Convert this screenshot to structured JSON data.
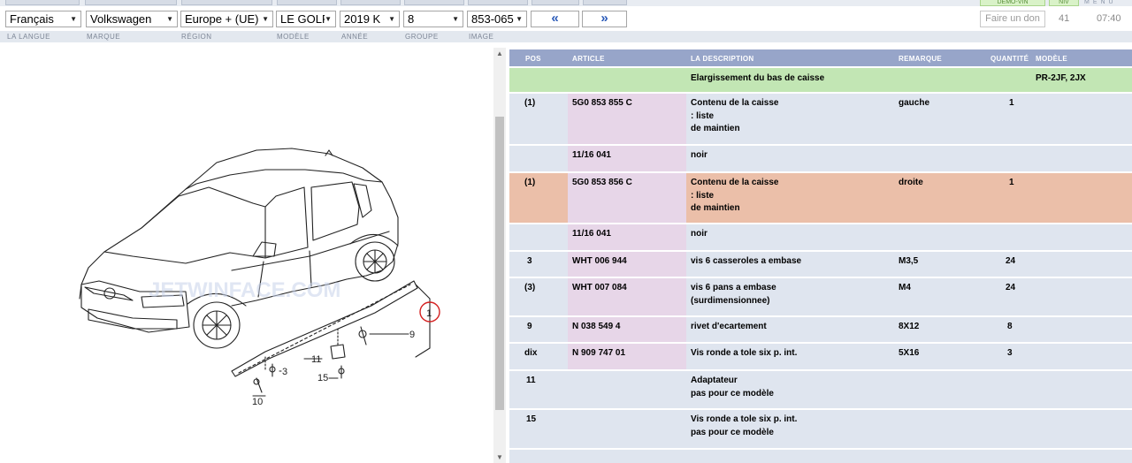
{
  "selectors": {
    "language": "Français",
    "brand": "Volkswagen",
    "region": "Europe + (UE)",
    "model": "LE GOLF",
    "year": "2019 K",
    "group": "8",
    "image": "853-065"
  },
  "nav": {
    "prev": "«",
    "next": "»"
  },
  "donate_label": "Faire un don",
  "counter": "41",
  "time": "07:40",
  "labels": {
    "language": "LA LANGUE",
    "brand": "MARQUE",
    "region": "RÉGION",
    "model": "MODÈLE",
    "year": "ANNÉE",
    "group": "GROUPE",
    "image": "IMAGE"
  },
  "header_right": {
    "chip1": "DEMO-VIN",
    "chip2": "NIV",
    "menu": "MENU"
  },
  "table": {
    "headers": {
      "pos": "POS",
      "article": "ARTICLE",
      "description": "LA DESCRIPTION",
      "remark": "REMARQUE",
      "quantity": "QUANTITÉ",
      "model": "MODÈLE"
    },
    "section": {
      "description": "Elargissement du bas de caisse",
      "model": "PR-2JF, 2JX"
    },
    "rows": [
      {
        "pos": "(1)",
        "article": "5G0 853 855 C",
        "desc1": "Contenu de la caisse",
        "desc2": ": liste",
        "desc3": "de maintien",
        "remark": "gauche",
        "qty": "1"
      },
      {
        "pos": "",
        "article": "11/16 041",
        "desc1": "noir",
        "desc2": "",
        "desc3": "",
        "remark": "",
        "qty": ""
      },
      {
        "pos": "(1)",
        "article": "5G0 853 856 C",
        "desc1": "Contenu de la caisse",
        "desc2": ": liste",
        "desc3": "de maintien",
        "remark": "droite",
        "qty": "1"
      },
      {
        "pos": "",
        "article": "11/16 041",
        "desc1": "noir",
        "desc2": "",
        "desc3": "",
        "remark": "",
        "qty": ""
      },
      {
        "pos": "3",
        "article": "WHT 006 944",
        "desc1": "vis 6 casseroles a embase",
        "desc2": "",
        "desc3": "",
        "remark": "M3,5",
        "qty": "24"
      },
      {
        "pos": "(3)",
        "article": "WHT 007 084",
        "desc1": "vis 6 pans a embase",
        "desc2": "(surdimensionnee)",
        "desc3": "",
        "remark": "M4",
        "qty": "24"
      },
      {
        "pos": "9",
        "article": "N 038 549 4",
        "desc1": "rivet d'ecartement",
        "desc2": "",
        "desc3": "",
        "remark": "8X12",
        "qty": "8"
      },
      {
        "pos": "dix",
        "article": "N 909 747 01",
        "desc1": "Vis ronde a tole six p. int.",
        "desc2": "",
        "desc3": "",
        "remark": "5X16",
        "qty": "3"
      },
      {
        "pos": "11",
        "article": "",
        "desc1": "Adaptateur",
        "desc2": "pas pour ce modèle",
        "desc3": "",
        "remark": "",
        "qty": ""
      },
      {
        "pos": "15",
        "article": "",
        "desc1": "Vis ronde a tole six p. int.",
        "desc2": "pas pour ce modèle",
        "desc3": "",
        "remark": "",
        "qty": ""
      }
    ]
  },
  "diagram": {
    "watermark": "JETWINFACE.COM",
    "callouts": {
      "c1": "1",
      "c3": "3",
      "c9": "9",
      "c10": "10",
      "c11": "11",
      "c15": "15"
    }
  },
  "colors": {
    "header": "#97a5c9",
    "section_green": "#c2e6b4",
    "highlight_salmon": "#ebbfa9",
    "row": "#dfe5ef",
    "article_col": "#e7d6e8",
    "callout_ring": "#d42020",
    "nav_arrow": "#2a5ab8"
  }
}
